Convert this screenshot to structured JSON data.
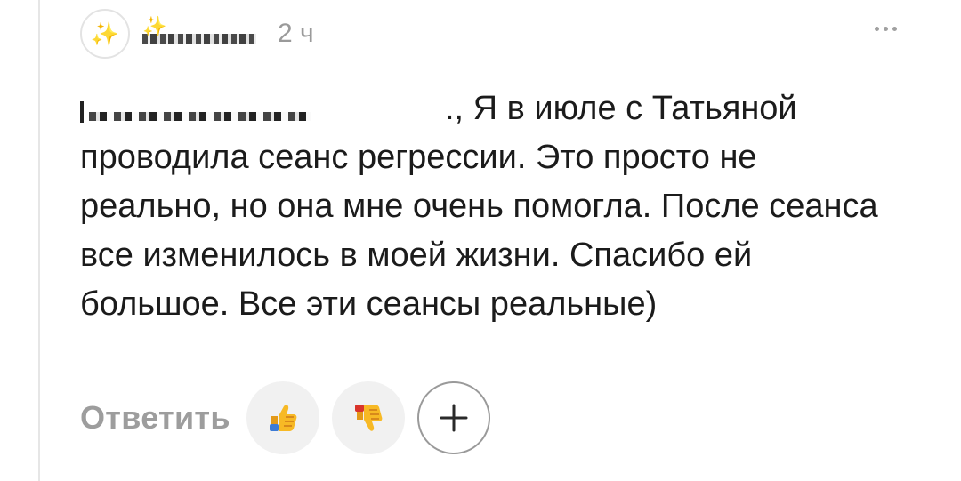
{
  "comment": {
    "author_emoji": "✨",
    "username_suffix": "✨",
    "timestamp": "2 ч",
    "text_after_name": "., Я в июле с Татьяной проводила сеанс регрессии. Это просто не реально, но она мне очень помогла. После сеанса все изменилось в моей жизни. Спасибо ей большое. Все эти сеансы реальные)"
  },
  "actions": {
    "reply_label": "Ответить",
    "like_icon": "thumbs-up",
    "dislike_icon": "thumbs-down",
    "add_reaction_icon": "plus"
  },
  "colors": {
    "text": "#1b1b1b",
    "muted": "#9a9a9a",
    "button_bg": "#f1f1f1"
  }
}
